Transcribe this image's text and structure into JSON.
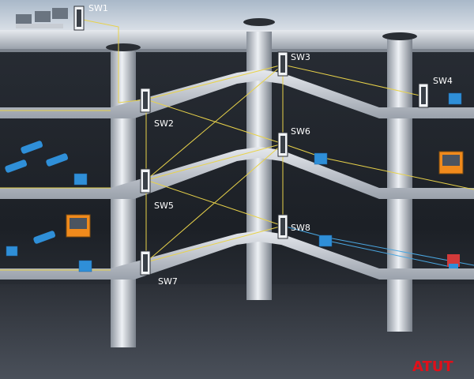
{
  "switches": [
    {
      "id": "sw1",
      "label": "SW1"
    },
    {
      "id": "sw2",
      "label": "SW2"
    },
    {
      "id": "sw3",
      "label": "SW3"
    },
    {
      "id": "sw4",
      "label": "SW4"
    },
    {
      "id": "sw5",
      "label": "SW5"
    },
    {
      "id": "sw6",
      "label": "SW6"
    },
    {
      "id": "sw7",
      "label": "SW7"
    },
    {
      "id": "sw8",
      "label": "SW8"
    }
  ],
  "logo": {
    "text": "ATUT"
  },
  "colors": {
    "link_yellow": "#e8d24a",
    "link_blue": "#4aa6e0",
    "floor": "#c9ced6",
    "pillar": "#d6dbe2",
    "device_blue": "#2f8fd8",
    "device_orange": "#f08a1c",
    "logo_red": "#e0101a"
  }
}
